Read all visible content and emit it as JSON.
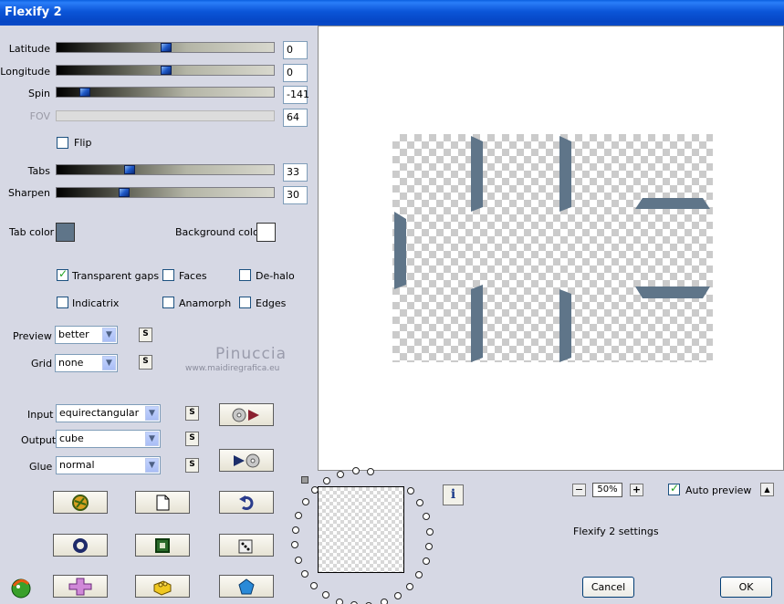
{
  "window": {
    "title": "Flexify 2"
  },
  "sliders": [
    {
      "label": "Latitude",
      "value": "0",
      "level": 0.5
    },
    {
      "label": "Longitude",
      "value": "0",
      "level": 0.5
    },
    {
      "label": "Spin",
      "value": "-141",
      "level": 0.11
    },
    {
      "label": "FOV",
      "value": "64",
      "level": null
    },
    {
      "label": "Tabs",
      "value": "33",
      "level": 0.33
    },
    {
      "label": "Sharpen",
      "value": "30",
      "level": 0.3
    }
  ],
  "flip": {
    "label": "Flip",
    "checked": false
  },
  "colors": {
    "tab_color_label": "Tab color",
    "tab_color": "#5f7589",
    "background_color_label": "Background color",
    "background_color": "#ffffff"
  },
  "options": {
    "transparent_gaps": {
      "label": "Transparent gaps",
      "checked": true
    },
    "faces": {
      "label": "Faces",
      "checked": false
    },
    "de_halo": {
      "label": "De-halo",
      "checked": false
    },
    "indicatrix": {
      "label": "Indicatrix",
      "checked": false
    },
    "anamorph": {
      "label": "Anamorph",
      "checked": false
    },
    "edges": {
      "label": "Edges",
      "checked": false
    }
  },
  "preview_select": {
    "label": "Preview",
    "value": "better"
  },
  "grid_select": {
    "label": "Grid",
    "value": "none"
  },
  "input_select": {
    "label": "Input",
    "value": "equirectangular"
  },
  "output_select": {
    "label": "Output",
    "value": "cube"
  },
  "glue_select": {
    "label": "Glue",
    "value": "normal"
  },
  "small_button_label": "S",
  "watermark": {
    "name": "Pinuccia",
    "url": "www.maidiregrafica.eu"
  },
  "zoom": {
    "minus": "−",
    "value": "50%",
    "plus": "+"
  },
  "auto_preview": {
    "label": "Auto preview",
    "checked": true
  },
  "up_button": "▲",
  "info_button": "i",
  "settings_text": "Flexify 2 settings",
  "buttons": {
    "cancel": "Cancel",
    "ok": "OK"
  }
}
